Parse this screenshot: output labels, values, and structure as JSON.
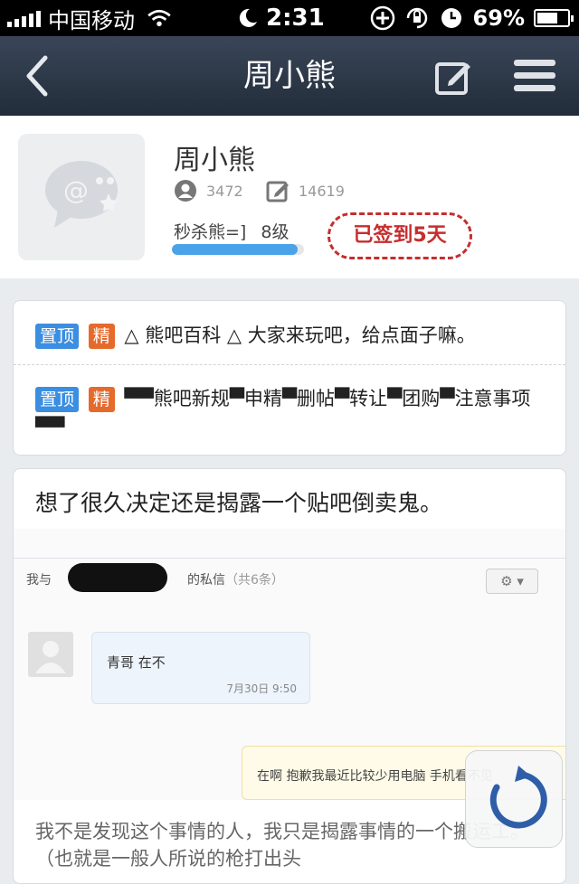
{
  "status_bar": {
    "carrier": "中国移动",
    "time": "2:31",
    "battery": "69%",
    "battery_level": 0.69
  },
  "nav": {
    "title": "周小熊"
  },
  "profile": {
    "name": "周小熊",
    "members": "3472",
    "posts": "14619",
    "member_title": "秒杀熊=]",
    "level": "8级",
    "level_progress": 0.95,
    "signin_label_prefix": "已签到",
    "signin_days": "5",
    "signin_label_suffix": "天"
  },
  "pinned": [
    {
      "badge_top": "置顶",
      "badge_jing": "精",
      "title": "△ 熊吧百科 △ 大家来玩吧，给点面子嘛。"
    },
    {
      "badge_top": "置顶",
      "badge_jing": "精",
      "title": "▀▀熊吧新规▀申精▀删帖▀转让▀团购▀注意事项▀▀"
    }
  ],
  "post": {
    "title": "想了很久决定还是揭露一个贴吧倒卖鬼。",
    "screenshot": {
      "header_prefix": "我与",
      "header_suffix": "的私信",
      "header_count": "（共6条）",
      "gear": "⚙ ▾",
      "msg1": "青哥 在不",
      "msg1_time": "7月30日 9:50",
      "msg2": "在啊 抱歉我最近比较少用电脑 手机看不见"
    },
    "body": "我不是发现这个事情的人，我只是揭露事情的一个搬运工。（也就是一般人所说的枪打出头"
  },
  "colors": {
    "navbar": "#2c3645",
    "accent_blue": "#3b8ee0",
    "badge_orange": "#e56a2c",
    "signin_red": "#c62e2e"
  }
}
